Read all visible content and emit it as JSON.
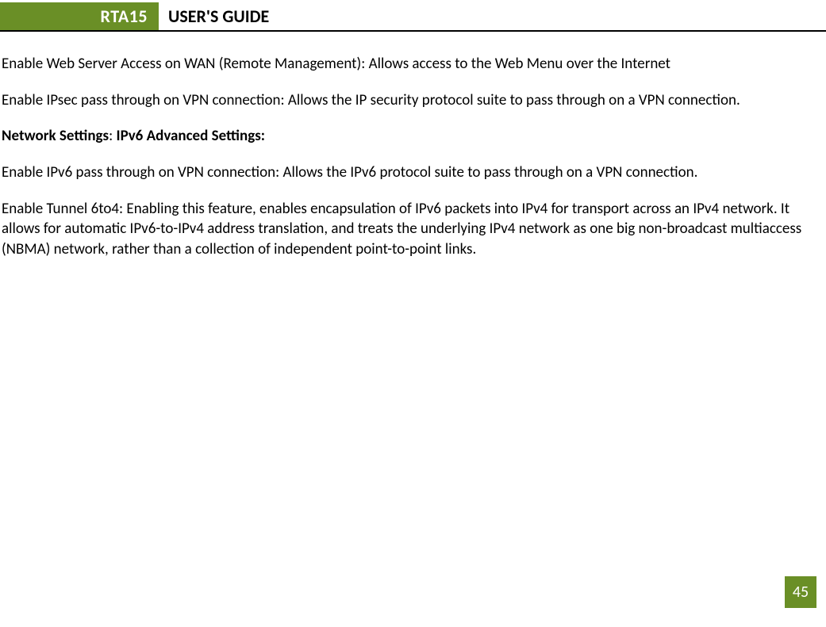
{
  "header": {
    "model": "RTA15",
    "title": "USER'S GUIDE"
  },
  "content": {
    "para1": "Enable Web Server Access on WAN (Remote Management): Allows access to the Web Menu over the Internet",
    "para2": "Enable IPsec pass through on VPN connection: Allows the IP security protocol suite to pass through on a VPN connection.",
    "section_heading_part1": "Network Settings",
    "section_heading_sep": ": ",
    "section_heading_part2": "IPv6 Advanced Settings:",
    "para3": "Enable IPv6 pass through on VPN connection: Allows the IPv6 protocol suite to pass through on a VPN connection.",
    "para4": "Enable Tunnel 6to4:  Enabling this feature, enables encapsulation of IPv6 packets into IPv4 for transport across an IPv4 network.  It allows for automatic IPv6-to-IPv4 address translation, and treats the underlying IPv4 network as one big non-broadcast multiaccess (NBMA) network, rather than a collection of independent point-to-point links."
  },
  "page_number": "45"
}
